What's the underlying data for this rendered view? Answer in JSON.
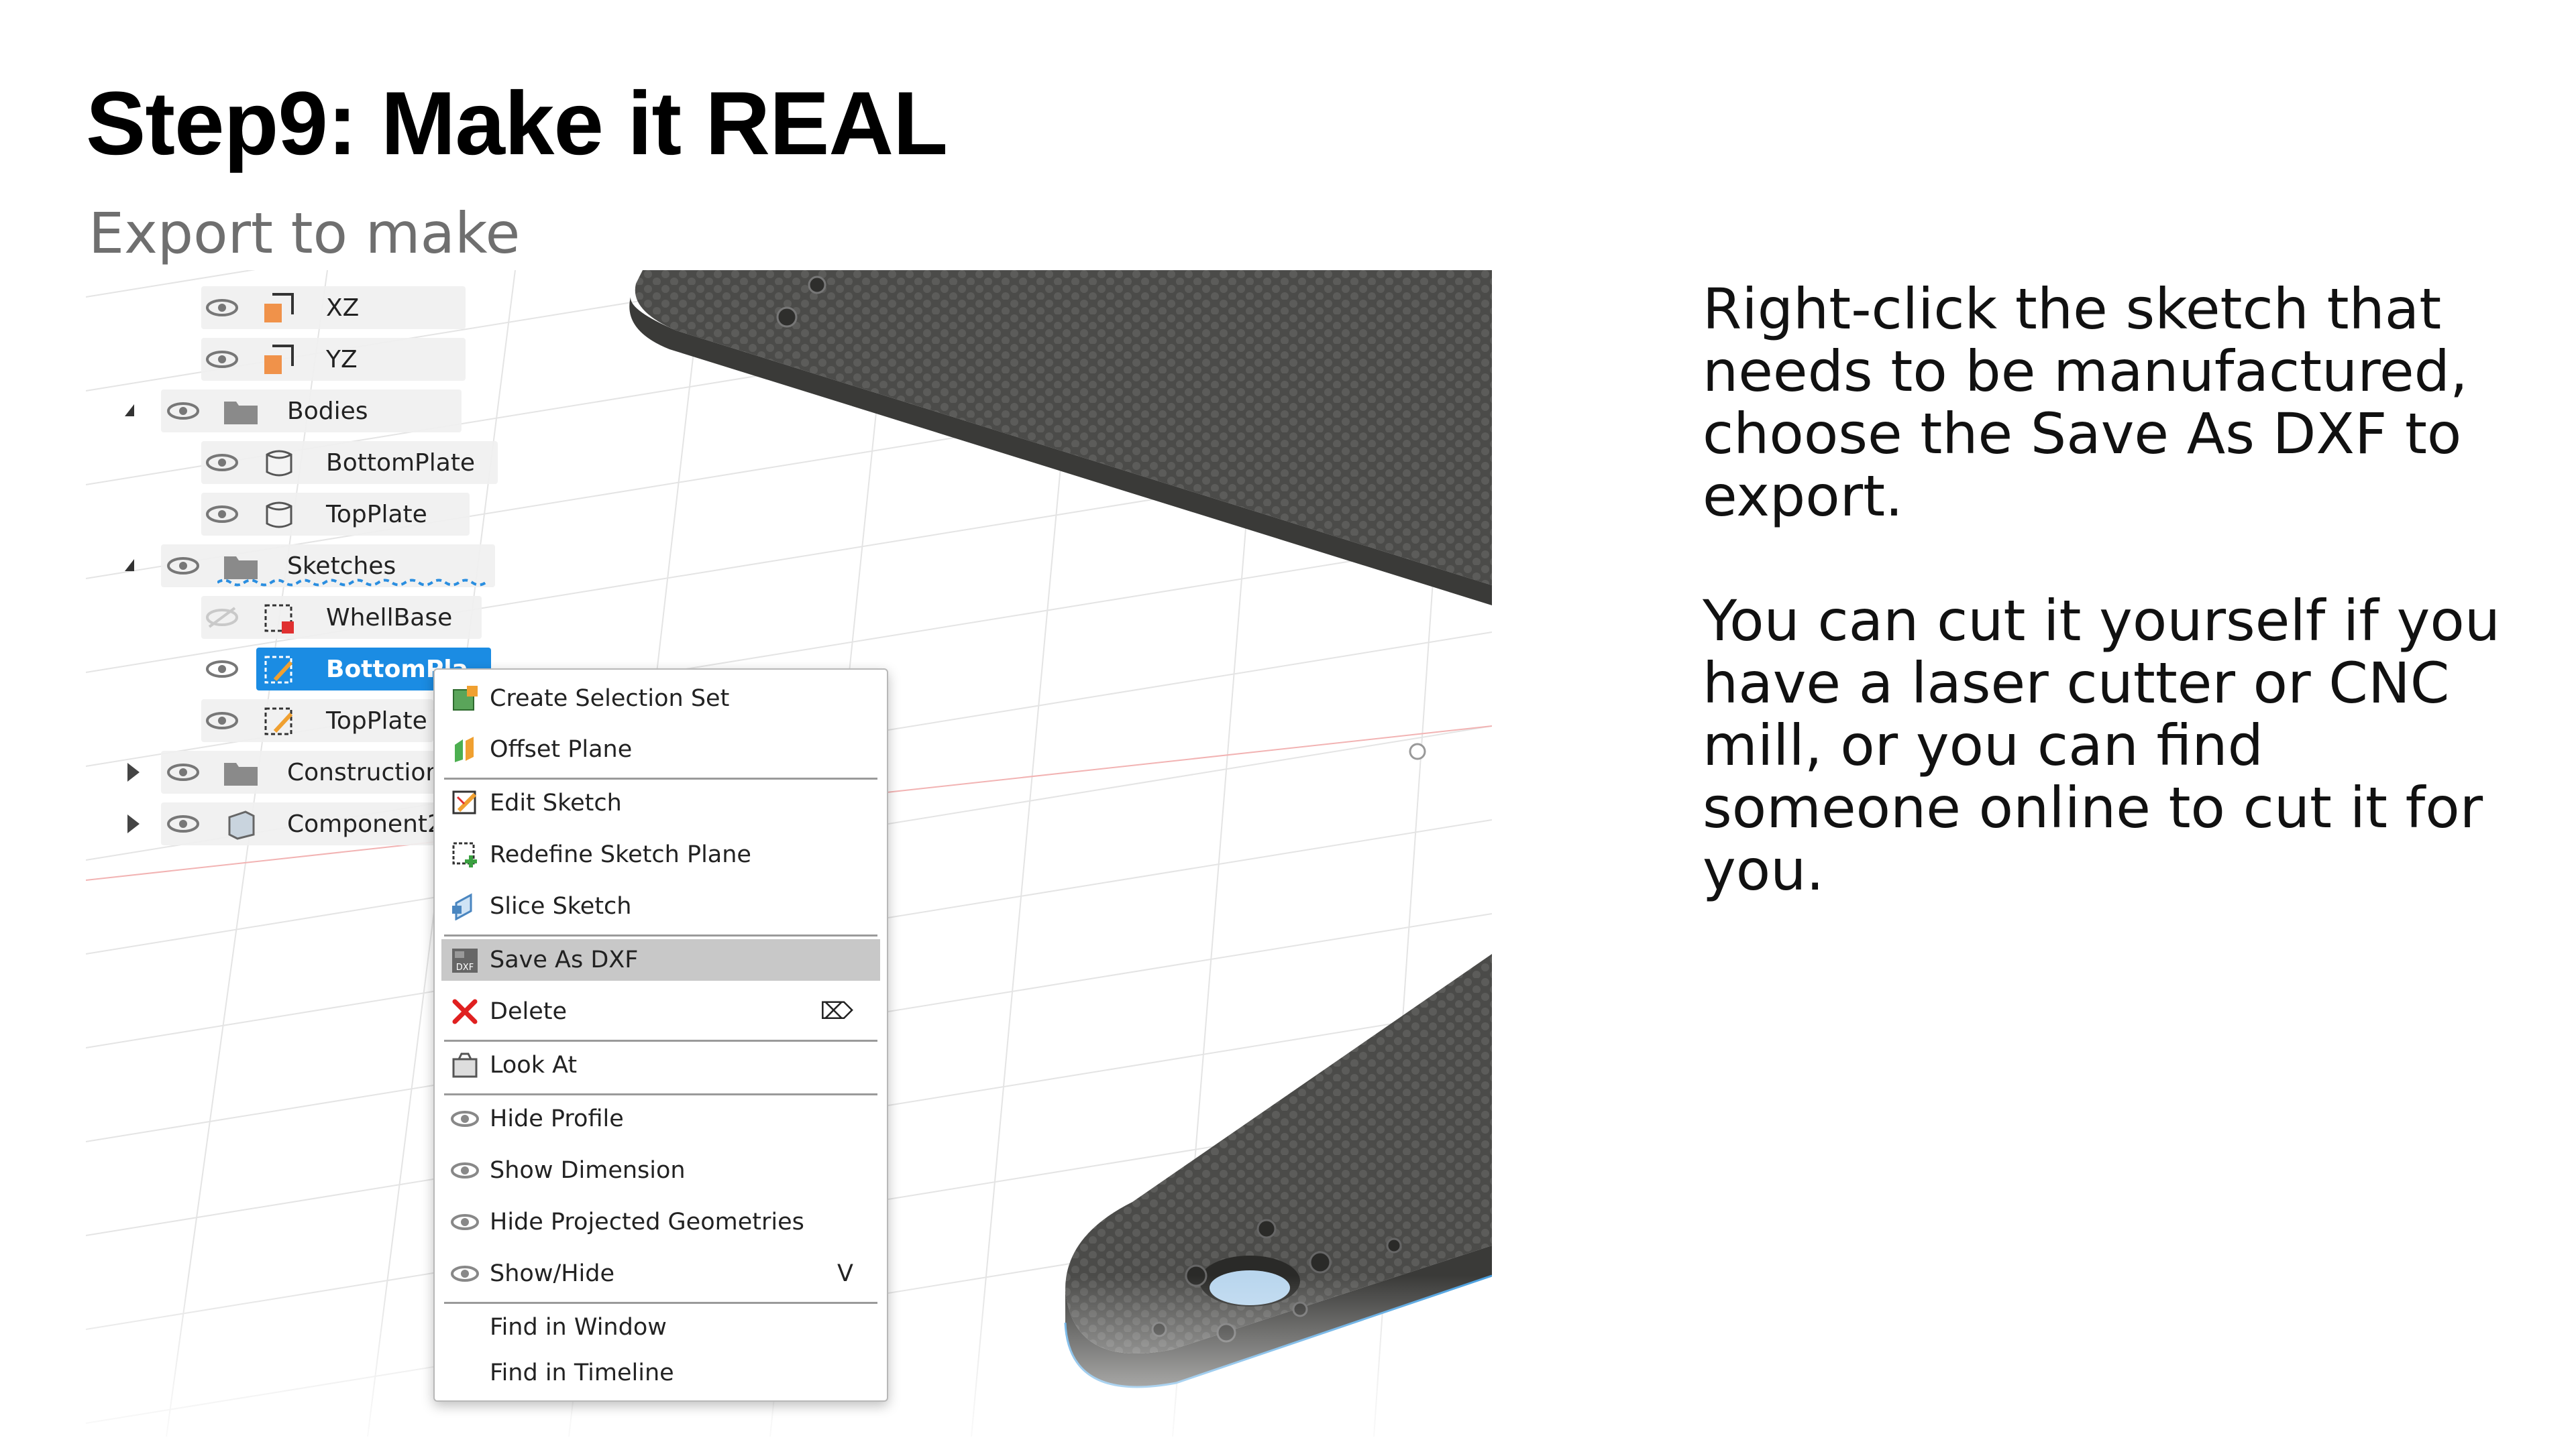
{
  "slide": {
    "title": "Step9: Make it REAL",
    "subtitle": "Export to make",
    "paragraph1": "Right-click the sketch that needs to be manufactured, choose the Save As DXF to export.",
    "paragraph2": "You can cut it yourself if you have a laser cutter or CNC mill, or you can find someone online to cut it for you."
  },
  "browser": {
    "items": [
      {
        "label": "XZ",
        "icon": "plane-icon"
      },
      {
        "label": "YZ",
        "icon": "plane-icon"
      },
      {
        "label": "Bodies",
        "icon": "folder-icon"
      },
      {
        "label": "BottomPlate",
        "icon": "body-icon"
      },
      {
        "label": "TopPlate",
        "icon": "body-icon"
      },
      {
        "label": "Sketches",
        "icon": "folder-icon"
      },
      {
        "label": "WhellBase",
        "icon": "sketch-icon"
      },
      {
        "label": "BottomPla",
        "icon": "sketch-icon"
      },
      {
        "label": "TopPlate",
        "icon": "sketch-icon"
      },
      {
        "label": "Construction",
        "icon": "folder-icon"
      },
      {
        "label": "Component2",
        "icon": "component-icon"
      }
    ]
  },
  "context_menu": {
    "items": [
      {
        "label": "Create Selection Set",
        "icon": "selection-set-icon"
      },
      {
        "label": "Offset Plane",
        "icon": "offset-plane-icon"
      },
      {
        "label": "Edit Sketch",
        "icon": "edit-sketch-icon"
      },
      {
        "label": "Redefine Sketch Plane",
        "icon": "redefine-plane-icon"
      },
      {
        "label": "Slice Sketch",
        "icon": "slice-icon"
      },
      {
        "label": "Save As DXF",
        "icon": "dxf-icon"
      },
      {
        "label": "Delete",
        "icon": "delete-icon",
        "shortcut": "⌦"
      },
      {
        "label": "Look At",
        "icon": "look-at-icon"
      },
      {
        "label": "Hide Profile",
        "icon": "eye-icon"
      },
      {
        "label": "Show Dimension",
        "icon": "eye-icon"
      },
      {
        "label": "Hide Projected Geometries",
        "icon": "eye-icon"
      },
      {
        "label": "Show/Hide",
        "icon": "eye-icon",
        "shortcut": "V"
      },
      {
        "label": "Find in Window"
      },
      {
        "label": "Find in Timeline"
      }
    ],
    "highlighted": "Save As DXF"
  },
  "colors": {
    "selection": "#1b8ce3",
    "plate": "#4a4a48",
    "highlight": "#c8c8c8",
    "delete": "#e02020"
  }
}
